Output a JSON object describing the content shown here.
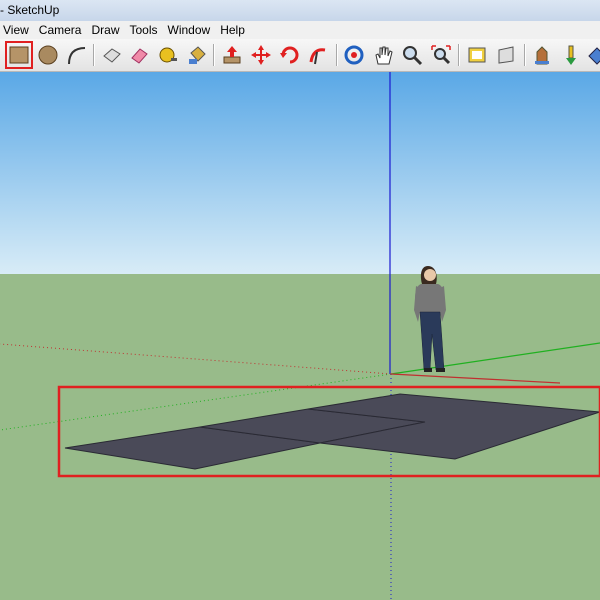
{
  "window": {
    "title": "- SketchUp"
  },
  "menu": [
    "View",
    "Camera",
    "Draw",
    "Tools",
    "Window",
    "Help"
  ],
  "toolbar": {
    "tools": [
      {
        "name": "rectangle-tool",
        "icon": "rectangle-icon",
        "active": true
      },
      {
        "name": "circle-tool",
        "icon": "circle-icon"
      },
      {
        "name": "arc-tool",
        "icon": "arc-icon"
      },
      {
        "name": "make-component-tool",
        "icon": "component-icon"
      },
      {
        "name": "eraser-tool",
        "icon": "eraser-icon"
      },
      {
        "name": "tape-measure-tool",
        "icon": "tape-measure-icon"
      },
      {
        "name": "paint-bucket-tool",
        "icon": "paint-bucket-icon"
      },
      {
        "name": "push-pull-tool",
        "icon": "push-pull-icon"
      },
      {
        "name": "move-tool",
        "icon": "move-icon"
      },
      {
        "name": "rotate-tool",
        "icon": "rotate-icon"
      },
      {
        "name": "follow-me-tool",
        "icon": "follow-me-icon"
      },
      {
        "name": "orbit-tool",
        "icon": "orbit-icon"
      },
      {
        "name": "pan-tool",
        "icon": "pan-hand-icon"
      },
      {
        "name": "zoom-tool",
        "icon": "zoom-icon"
      },
      {
        "name": "zoom-extents-tool",
        "icon": "zoom-extents-icon"
      },
      {
        "name": "get-models-tool",
        "icon": "get-models-icon"
      },
      {
        "name": "share-model-tool",
        "icon": "share-model-icon"
      },
      {
        "name": "components-tool",
        "icon": "components-icon"
      },
      {
        "name": "extension-tool",
        "icon": "extension-icon"
      },
      {
        "name": "shadow-tool",
        "icon": "shadow-icon"
      }
    ]
  },
  "colors": {
    "sky_top": "#5aa8e6",
    "sky_horizon": "#d8ecf7",
    "ground": "#98bb8a",
    "surface": "#4a4a58",
    "highlight": "#e02020",
    "axis_blue": "#1a1ad0",
    "axis_green": "#20b020",
    "axis_red": "#c03030"
  }
}
